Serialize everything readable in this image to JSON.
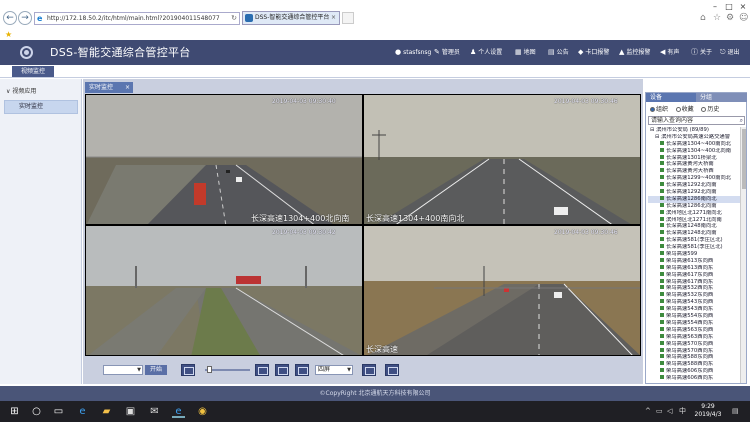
{
  "browser": {
    "url": "http://172.18.50.2/itc/html/main.html?201904011548077",
    "tab_title": "DSS-智能交通综合管控平台"
  },
  "app": {
    "title": "DSS-智能交通综合管控平台",
    "header_items": [
      {
        "icon": "user-icon",
        "label": "stasfsnsg"
      },
      {
        "icon": "wrench-icon",
        "label": "管理员"
      },
      {
        "icon": "person-icon",
        "label": "个人设置"
      },
      {
        "icon": "map-icon",
        "label": "地图"
      },
      {
        "icon": "notice-icon",
        "label": "公告"
      },
      {
        "icon": "alarm-icon",
        "label": "卡口报警"
      },
      {
        "icon": "alarm2-icon",
        "label": "监控报警"
      },
      {
        "icon": "sound-icon",
        "label": "有声"
      },
      {
        "icon": "info-icon",
        "label": "关于"
      },
      {
        "icon": "exit-icon",
        "label": "退出"
      }
    ],
    "module_tab": "视频监控"
  },
  "left_menu": {
    "group": "视频应用",
    "item": "实时监控"
  },
  "main": {
    "tab_label": "实时监控",
    "videos": [
      {
        "timestamp": "2019-04-03 09:30:40",
        "location": "长深高速1304+400北向南"
      },
      {
        "timestamp": "2019-04-03 09:30:46",
        "location": "长深高速1304+400南向北"
      },
      {
        "timestamp": "2019-04-03 09:30:42",
        "location": ""
      },
      {
        "timestamp": "2019-04-03 09:30:46",
        "location": "长深高速"
      }
    ],
    "controls": {
      "stream_select": "",
      "start_button": "开始",
      "layout_select": "四屏"
    }
  },
  "right_panel": {
    "tabs": [
      "设备",
      "分组"
    ],
    "radios": [
      "组织",
      "收藏",
      "历史"
    ],
    "search_placeholder": "请输入查询内容",
    "tree": [
      "滨州市公安局 (89/89)",
      "滨州市公安局高速公路交通警",
      "长深高速1304~400南向北",
      "长深高速1304~400北向南",
      "长深高速1301桥梁北",
      "长深高速黄河大桥南",
      "长深高速黄河大桥西",
      "长深高速1299~400南向北",
      "长深高速1292北向南",
      "长深高速1292北向南",
      "长深高速1286南向北",
      "长深高速1286北向南",
      "滨州地区北1271南向北",
      "滨州地区北1271北向南",
      "长深高速1248南向北",
      "长深高速1248北向南",
      "长深高速581(李庄区北)",
      "长深高速581(李庄区北)",
      "荣乌高速599",
      "荣乌高速613东向西",
      "荣乌高速613西向东",
      "荣乌高速617东向西",
      "荣乌高速617西向东",
      "荣乌高速532西向东",
      "荣乌高速532东向西",
      "荣乌高速543东向西",
      "荣乌高速543西向东",
      "荣乌高速554东向西",
      "荣乌高速554西向东",
      "荣乌高速563东向西",
      "荣乌高速563西向东",
      "荣乌高速570东向西",
      "荣乌高速570西向东",
      "荣乌高速588东向西",
      "荣乌高速588西向东",
      "荣乌高速606东向西",
      "荣乌高速606西向东"
    ]
  },
  "footer": "©CopyRight 北京通航天方科技有限公司",
  "taskbar": {
    "time": "9:29",
    "date": "2019/4/3",
    "ime": "中"
  }
}
